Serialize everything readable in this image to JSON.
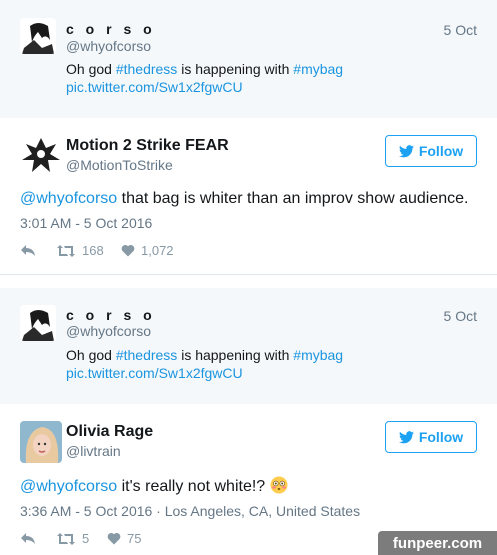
{
  "tweets": [
    {
      "type": "reply_context",
      "user_name": "c o r s o",
      "handle": "@whyofcorso",
      "date": "5 Oct",
      "text_prefix": "Oh god ",
      "hashtag1": "#thedress",
      "text_middle": " is happening with ",
      "hashtag2": "#mybag",
      "link": "pic.twitter.com/Sw1x2fgwCU"
    },
    {
      "type": "main",
      "user_name": "Motion 2 Strike FEAR",
      "handle": "@MotionToStrike",
      "follow_label": "Follow",
      "mention": "@whyofcorso",
      "text": " that bag is whiter than an improv show audience.",
      "meta": "3:01 AM - 5 Oct 2016",
      "retweets": "168",
      "likes": "1,072"
    },
    {
      "type": "reply_context",
      "user_name": "c o r s o",
      "handle": "@whyofcorso",
      "date": "5 Oct",
      "text_prefix": "Oh god ",
      "hashtag1": "#thedress",
      "text_middle": " is happening with ",
      "hashtag2": "#mybag",
      "link": "pic.twitter.com/Sw1x2fgwCU"
    },
    {
      "type": "main",
      "user_name": "Olivia Rage",
      "handle": "@livtrain",
      "follow_label": "Follow",
      "mention": "@whyofcorso",
      "text": " it's really not white!? ",
      "meta": "3:36 AM - 5 Oct 2016 · Los Angeles, CA, United States",
      "retweets": "5",
      "likes": "75"
    }
  ],
  "icons": {
    "reply": "reply-icon",
    "retweet": "retweet-icon",
    "like": "heart-icon",
    "twitter_bird": "twitter-bird-icon",
    "emoji": "flushed-face-emoji"
  },
  "colors": {
    "link": "#1b95e0",
    "follow": "#1da1f2",
    "reply_bg": "#f5f8fa",
    "muted": "#657786"
  },
  "watermark": "funpeer.com"
}
